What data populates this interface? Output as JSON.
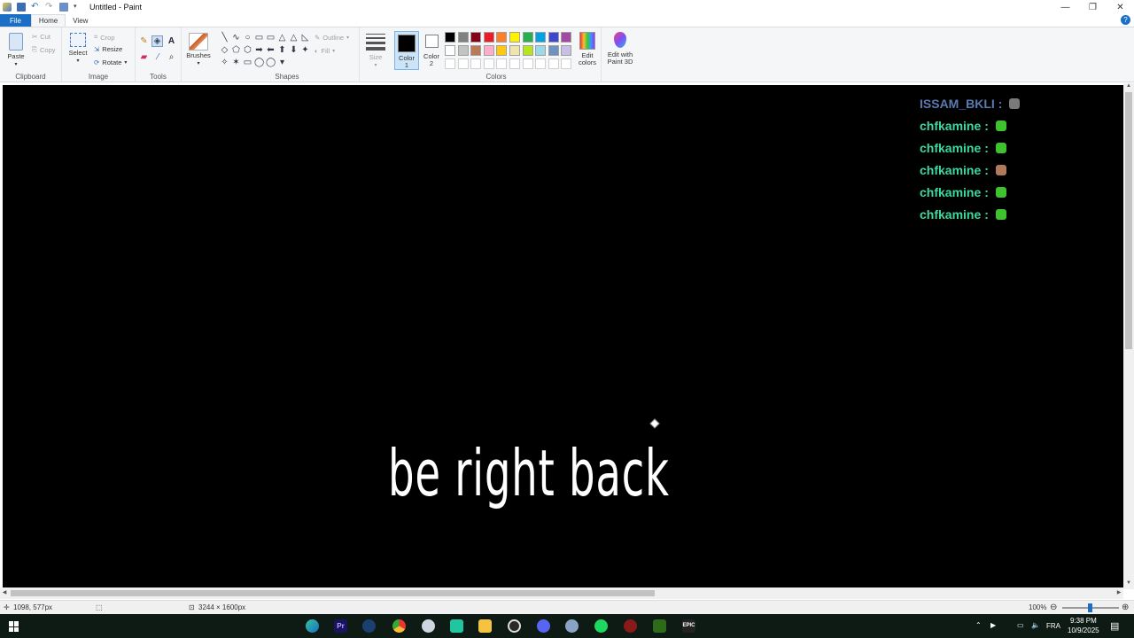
{
  "window": {
    "title": "Untitled - Paint"
  },
  "tabs": [
    "File",
    "Home",
    "View"
  ],
  "clipboard": {
    "paste": "Paste",
    "cut": "Cut",
    "copy": "Copy",
    "group": "Clipboard"
  },
  "image": {
    "select": "Select",
    "crop": "Crop",
    "resize": "Resize",
    "rotate": "Rotate",
    "group": "Image"
  },
  "tools": {
    "group": "Tools"
  },
  "brushes": {
    "label": "Brushes"
  },
  "shapes": {
    "outline": "Outline",
    "fill": "Fill",
    "group": "Shapes"
  },
  "size": {
    "label": "Size"
  },
  "colors": {
    "color1": "Color\n1",
    "color1_a": "Color",
    "color1_b": "1",
    "color2_a": "Color",
    "color2_b": "2",
    "edit_a": "Edit",
    "edit_b": "colors",
    "paint3d_a": "Edit with",
    "paint3d_b": "Paint 3D",
    "group": "Colors",
    "palette_row1": [
      "#000000",
      "#7f7f7f",
      "#880015",
      "#ed1c24",
      "#ff7f27",
      "#fff200",
      "#22b14c",
      "#00a2e8",
      "#3f48cc",
      "#a349a4"
    ],
    "palette_row2": [
      "#ffffff",
      "#c3c3c3",
      "#b97a57",
      "#ffaec9",
      "#ffc90e",
      "#efe4b0",
      "#b5e61d",
      "#99d9ea",
      "#7092be",
      "#c8bfe7"
    ]
  },
  "chat": [
    {
      "user": "ISSAM_BKLI",
      "sep": ":",
      "color": "#5a7ab0",
      "emote": "#7a7a7a"
    },
    {
      "user": "chfkamine",
      "sep": ":",
      "color": "#3fd9a0",
      "emote": "#3ec22e"
    },
    {
      "user": "chfkamine",
      "sep": ":",
      "color": "#3fd9a0",
      "emote": "#3ec22e"
    },
    {
      "user": "chfkamine",
      "sep": ":",
      "color": "#3fd9a0",
      "emote": "#b07a60"
    },
    {
      "user": "chfkamine",
      "sep": ":",
      "color": "#3fd9a0",
      "emote": "#3ec22e"
    },
    {
      "user": "chfkamine",
      "sep": ":",
      "color": "#3fd9a0",
      "emote": "#3ec22e"
    }
  ],
  "canvas_text": "be right back",
  "status": {
    "cursor": "1098, 577px",
    "dimensions": "3244 × 1600px",
    "zoom": "100%"
  },
  "taskbar": {
    "lang": "FRA",
    "time": "9:38 PM",
    "date": "10/9/2025"
  }
}
